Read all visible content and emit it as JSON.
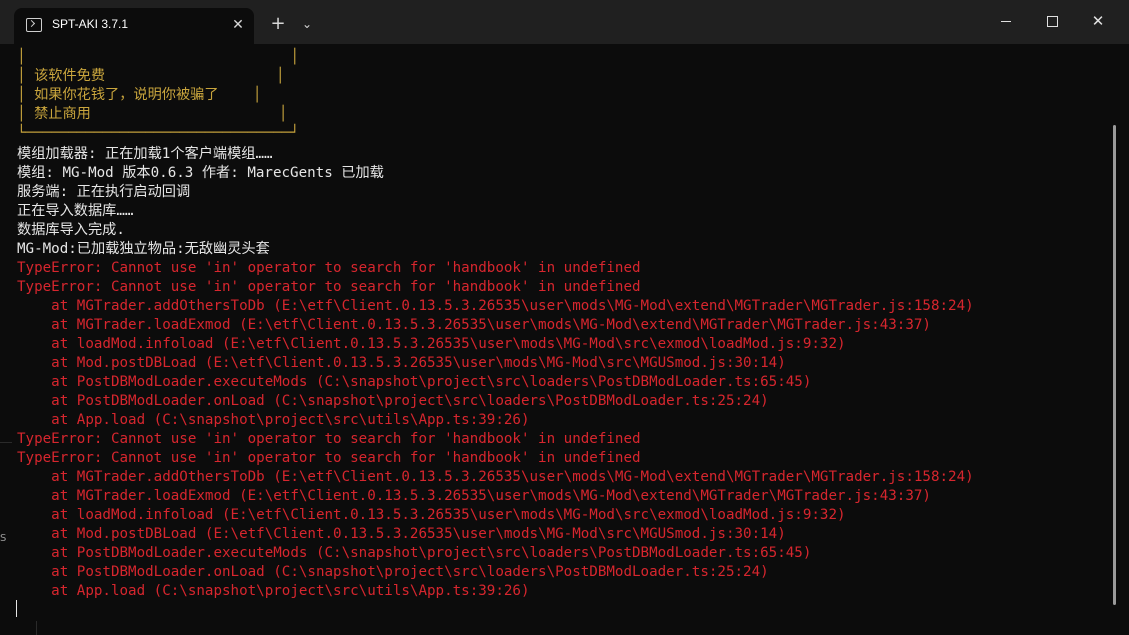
{
  "window": {
    "tab_title": "SPT-AKI 3.7.1",
    "tab_close_glyph": "✕",
    "new_tab_glyph": "+",
    "dropdown_glyph": "⌄",
    "close_glyph": "✕",
    "edge_glyph": "S"
  },
  "terminal": {
    "banner_lines": [
      "│                               │",
      "│ 该软件免费                    │",
      "│ 如果你花钱了，说明你被骗了    │",
      "│ 禁止商用                      │",
      "└───────────────────────────────┘"
    ],
    "info_lines": [
      "模组加载器: 正在加载1个客户端模组……",
      "模组: MG-Mod 版本0.6.3 作者: MarecGents 已加载",
      "服务端: 正在执行启动回调",
      "正在导入数据库……",
      "数据库导入完成.",
      "MG-Mod:已加载独立物品:无敌幽灵头套"
    ],
    "error_lines": [
      "TypeError: Cannot use 'in' operator to search for 'handbook' in undefined",
      "TypeError: Cannot use 'in' operator to search for 'handbook' in undefined",
      "    at MGTrader.addOthersToDb (E:\\etf\\Client.0.13.5.3.26535\\user\\mods\\MG-Mod\\extend\\MGTrader\\MGTrader.js:158:24)",
      "    at MGTrader.loadExmod (E:\\etf\\Client.0.13.5.3.26535\\user\\mods\\MG-Mod\\extend\\MGTrader\\MGTrader.js:43:37)",
      "    at loadMod.infoload (E:\\etf\\Client.0.13.5.3.26535\\user\\mods\\MG-Mod\\src\\exmod\\loadMod.js:9:32)",
      "    at Mod.postDBLoad (E:\\etf\\Client.0.13.5.3.26535\\user\\mods\\MG-Mod\\src\\MGUSmod.js:30:14)",
      "    at PostDBModLoader.executeMods (C:\\snapshot\\project\\src\\loaders\\PostDBModLoader.ts:65:45)",
      "    at PostDBModLoader.onLoad (C:\\snapshot\\project\\src\\loaders\\PostDBModLoader.ts:25:24)",
      "    at App.load (C:\\snapshot\\project\\src\\utils\\App.ts:39:26)",
      "TypeError: Cannot use 'in' operator to search for 'handbook' in undefined",
      "TypeError: Cannot use 'in' operator to search for 'handbook' in undefined",
      "    at MGTrader.addOthersToDb (E:\\etf\\Client.0.13.5.3.26535\\user\\mods\\MG-Mod\\extend\\MGTrader\\MGTrader.js:158:24)",
      "    at MGTrader.loadExmod (E:\\etf\\Client.0.13.5.3.26535\\user\\mods\\MG-Mod\\extend\\MGTrader\\MGTrader.js:43:37)",
      "    at loadMod.infoload (E:\\etf\\Client.0.13.5.3.26535\\user\\mods\\MG-Mod\\src\\exmod\\loadMod.js:9:32)",
      "    at Mod.postDBLoad (E:\\etf\\Client.0.13.5.3.26535\\user\\mods\\MG-Mod\\src\\MGUSmod.js:30:14)",
      "    at PostDBModLoader.executeMods (C:\\snapshot\\project\\src\\loaders\\PostDBModLoader.ts:65:45)",
      "    at PostDBModLoader.onLoad (C:\\snapshot\\project\\src\\loaders\\PostDBModLoader.ts:25:24)",
      "    at App.load (C:\\snapshot\\project\\src\\utils\\App.ts:39:26)"
    ]
  },
  "colors": {
    "banner": "#c9a53d",
    "info": "#e6e6e6",
    "error": "#d7262e",
    "background": "#0c0c0c",
    "titlebar": "#202020"
  },
  "icons": {
    "tab_icon": "terminal-icon",
    "close": "close-icon",
    "new_tab": "plus-icon",
    "dropdown": "chevron-down-icon",
    "minimize": "minimize-icon",
    "maximize": "maximize-icon"
  }
}
